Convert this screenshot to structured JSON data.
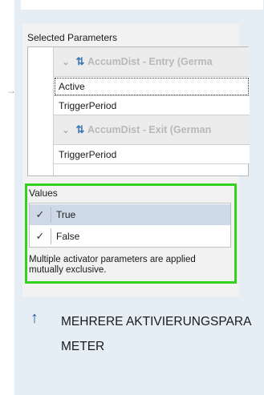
{
  "selected_parameters": {
    "label": "Selected Parameters",
    "groups": [
      {
        "name": "AccumDist - Entry (Germa",
        "rows": [
          "Active",
          "TriggerPeriod"
        ]
      },
      {
        "name": "AccumDist - Exit (German",
        "rows": [
          "TriggerPeriod"
        ]
      }
    ]
  },
  "values": {
    "label": "Values",
    "items": [
      {
        "label": "True",
        "checked": true,
        "selected": true
      },
      {
        "label": "False",
        "checked": true,
        "selected": false
      }
    ],
    "note": "Multiple activator parameters are applied mutually exclusive."
  },
  "heading": {
    "icon": "up-arrow-icon",
    "text": "MEHRERE AKTIVIERUNGSPARAMETER"
  },
  "colors": {
    "highlight_border": "#33d21e",
    "panel_bg": "#e6eef5",
    "selected_row": "#cdd9e6"
  }
}
